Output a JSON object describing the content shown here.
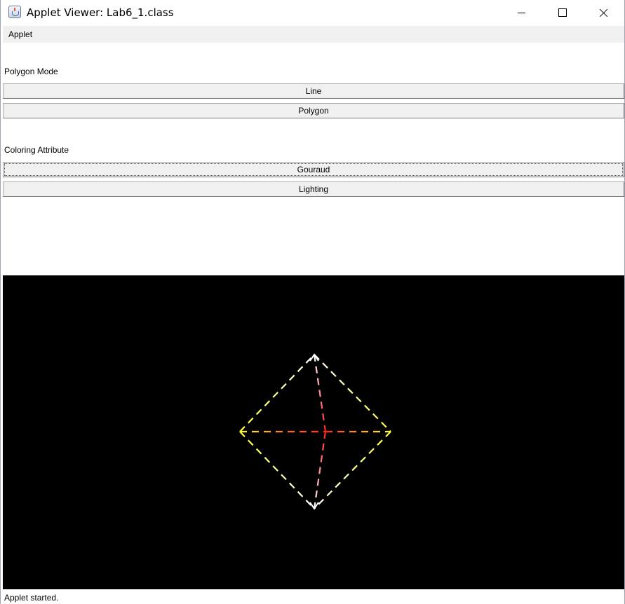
{
  "window": {
    "title": "Applet Viewer: Lab6_1.class",
    "icon": "java-applet-icon"
  },
  "menubar": {
    "items": [
      "Applet"
    ]
  },
  "polygon_mode": {
    "label": "Polygon Mode",
    "buttons": [
      "Line",
      "Polygon"
    ]
  },
  "coloring": {
    "label": "Coloring Attribute",
    "buttons": [
      "Gouraud",
      "Lighting"
    ],
    "focused": "Gouraud"
  },
  "scene": {
    "background": "#000000",
    "shape": "octahedron wireframe",
    "render_mode": "dashed lines",
    "colors": {
      "vertex_top": "#ffffff",
      "vertex_bottom": "#ffffff",
      "vertex_left": "#ffff33",
      "vertex_right": "#ffff33",
      "vertex_center": "#ff2a1a"
    }
  },
  "status": {
    "text": "Applet started."
  }
}
